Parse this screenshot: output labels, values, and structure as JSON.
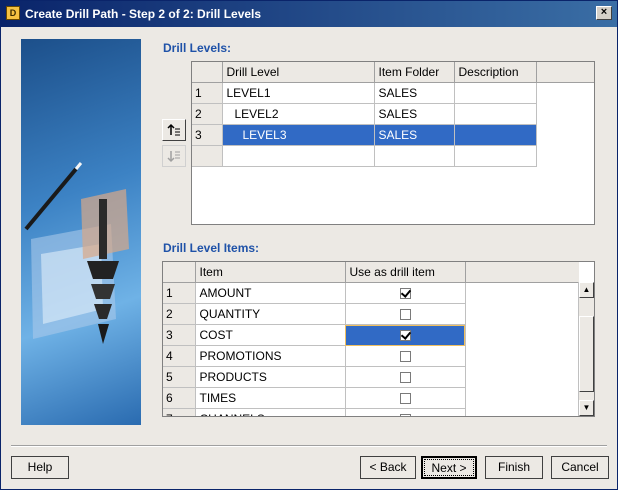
{
  "window": {
    "title": "Create Drill Path - Step 2 of 2: Drill Levels",
    "close_label": "×"
  },
  "drill_levels": {
    "section_label": "Drill Levels:",
    "columns": [
      "Drill Level",
      "Item Folder",
      "Description"
    ],
    "rows": [
      {
        "num": "1",
        "level": "LEVEL1",
        "folder": "SALES",
        "description": ""
      },
      {
        "num": "2",
        "level": "LEVEL2",
        "folder": "SALES",
        "description": ""
      },
      {
        "num": "3",
        "level": "LEVEL3",
        "folder": "SALES",
        "description": ""
      }
    ],
    "selected_row": "3"
  },
  "drill_level_items": {
    "section_label": "Drill Level Items:",
    "columns": [
      "Item",
      "Use as drill item"
    ],
    "rows": [
      {
        "num": "1",
        "item": "AMOUNT",
        "checked": true
      },
      {
        "num": "2",
        "item": "QUANTITY",
        "checked": false
      },
      {
        "num": "3",
        "item": "COST",
        "checked": true
      },
      {
        "num": "4",
        "item": "PROMOTIONS",
        "checked": false
      },
      {
        "num": "5",
        "item": "PRODUCTS",
        "checked": false
      },
      {
        "num": "6",
        "item": "TIMES",
        "checked": false
      },
      {
        "num": "7",
        "item": "CHANNELS",
        "checked": false
      }
    ],
    "selected_row": "3"
  },
  "buttons": {
    "help": "Help",
    "back": "< Back",
    "next": "Next >",
    "finish": "Finish",
    "cancel": "Cancel"
  },
  "icons": {
    "move_up": "move-up-icon",
    "move_down": "move-down-icon"
  },
  "colors": {
    "title_bar": "#0a246a",
    "section_label": "#1f52a8",
    "selection": "#316ac5"
  }
}
